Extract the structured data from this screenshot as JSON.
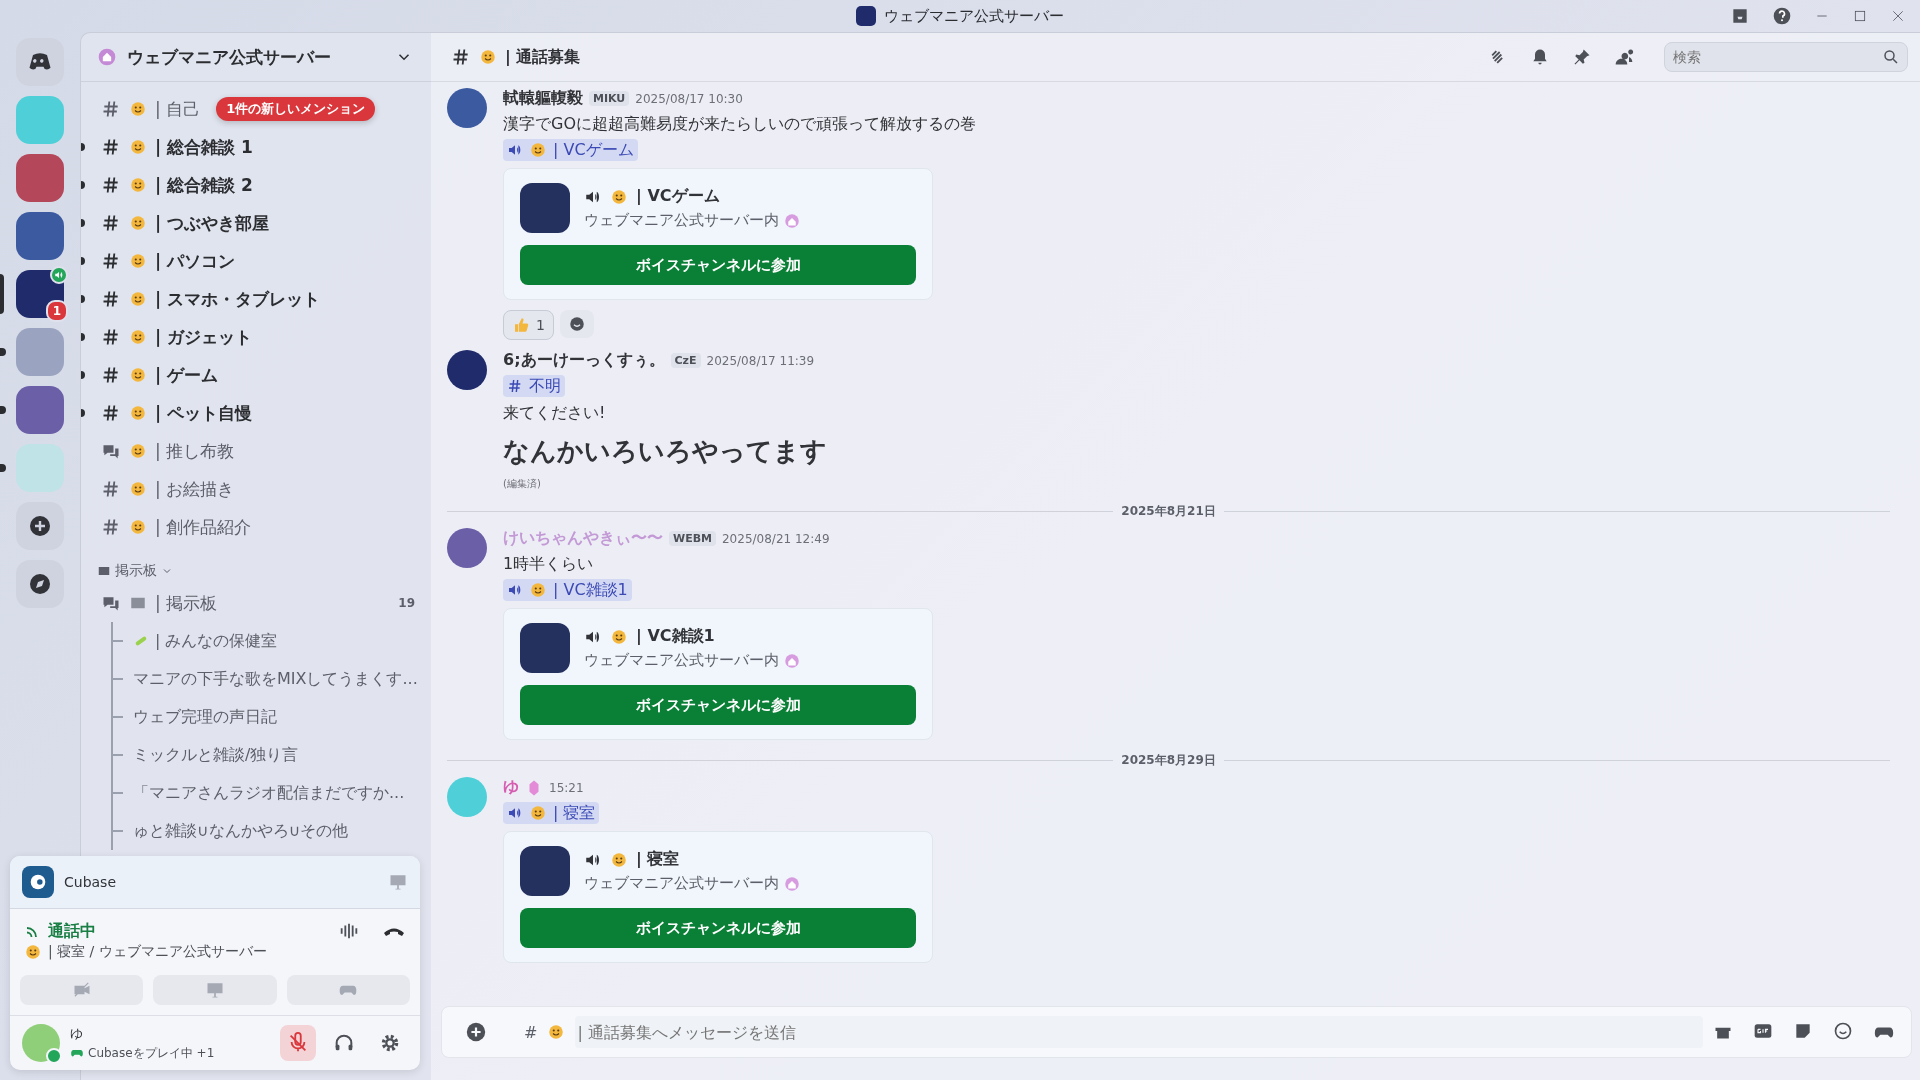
{
  "window": {
    "title": "ウェブマニア公式サーバー"
  },
  "servers": [
    {
      "selected": false,
      "unread": false,
      "voice": false
    },
    {
      "selected": false,
      "unread": false,
      "voice": false
    },
    {
      "selected": false,
      "unread": false,
      "voice": false
    },
    {
      "selected": true,
      "unread": false,
      "voice": true,
      "badge": "1"
    },
    {
      "selected": false,
      "unread": true,
      "voice": false
    },
    {
      "selected": false,
      "unread": true,
      "voice": false
    },
    {
      "selected": false,
      "unread": true,
      "voice": false
    }
  ],
  "server_header": {
    "name": "ウェブマニア公式サーバー"
  },
  "mention_badge": "1件の新しいメンション",
  "channels": [
    {
      "kind": "text",
      "name": "| 自己",
      "unread": false
    },
    {
      "kind": "text",
      "name": "| 総合雑談 1",
      "unread": true
    },
    {
      "kind": "text",
      "name": "| 総合雑談 2",
      "unread": true
    },
    {
      "kind": "text",
      "name": "| つぶやき部屋",
      "unread": true
    },
    {
      "kind": "text",
      "name": "| パソコン",
      "unread": true
    },
    {
      "kind": "text",
      "name": "| スマホ・タブレット",
      "unread": true
    },
    {
      "kind": "text",
      "name": "| ガジェット",
      "unread": true
    },
    {
      "kind": "text",
      "name": "| ゲーム",
      "unread": true
    },
    {
      "kind": "text",
      "name": "| ペット自慢",
      "unread": true
    },
    {
      "kind": "forum",
      "name": "| 推し布教",
      "unread": false
    },
    {
      "kind": "text",
      "name": "| お絵描き",
      "unread": false
    },
    {
      "kind": "text",
      "name": "| 創作品紹介",
      "unread": false
    }
  ],
  "forum_category": {
    "name": "掲示板",
    "expanded": true,
    "channels": [
      {
        "kind": "forum",
        "name": "| 掲示板",
        "count": "19",
        "children": [
          {
            "name": "| みんなの保健室",
            "icon": true
          },
          {
            "name": "マニアの下手な歌をMIXしてうまくす...",
            "icon": false
          },
          {
            "name": "ウェブ完理の声日記",
            "icon": false
          },
          {
            "name": "ミックルと雑談/独り言",
            "icon": false
          },
          {
            "name": "「マニアさんラジオ配信まだですか...",
            "icon": false
          },
          {
            "name": "ゅと雑談∪なんかやろ∪その他",
            "icon": false
          }
        ]
      }
    ]
  },
  "activity": {
    "name": "Cubase"
  },
  "voice": {
    "status": "通話中",
    "channel": "| 寝室 / ウェブマニア公式サーバー"
  },
  "user": {
    "name": "ゆ",
    "activity": "Cubaseをプレイ中",
    "extra": "+1",
    "muted": true
  },
  "chat_header": {
    "channel": "| 通話募集",
    "search_placeholder": "検索"
  },
  "messages": [
    {
      "kind": "message",
      "author": "軾轅軀輹毅",
      "color": "#313338",
      "tag": "MIKU",
      "time": "2025/08/17 10:30",
      "blocks": [
        {
          "kind": "text",
          "text": "漢字でGOに超超高難易度が来たらしいので頑張って解放するの巻"
        },
        {
          "kind": "mention",
          "voice_channel": true,
          "name": "| VCゲーム"
        },
        {
          "kind": "embed",
          "title": "| VCゲーム",
          "server": "ウェブマニア公式サーバー内",
          "button": "ボイスチャンネルに参加"
        },
        {
          "kind": "reactions",
          "items": [
            {
              "count": "1"
            }
          ]
        }
      ]
    },
    {
      "kind": "message",
      "author": "6;あーけーっくすぅ。",
      "color": "#313338",
      "tag": "CzE",
      "time": "2025/08/17 11:39",
      "blocks": [
        {
          "kind": "mention",
          "voice_channel": false,
          "name": "不明"
        },
        {
          "kind": "text",
          "text": "来てください!"
        },
        {
          "kind": "heading",
          "text": "なんかいろいろやってます"
        },
        {
          "kind": "edited",
          "text": "(編集済)"
        }
      ]
    },
    {
      "kind": "divider",
      "text": "2025年8月21日"
    },
    {
      "kind": "message",
      "author": "けいちゃんやきぃ〜〜",
      "color": "#c39ad6",
      "tag": "WEBM",
      "time": "2025/08/21 12:49",
      "blocks": [
        {
          "kind": "text",
          "text": "1時半くらい"
        },
        {
          "kind": "mention",
          "voice_channel": true,
          "name": "| VC雑談1"
        },
        {
          "kind": "embed",
          "title": "| VC雑談1",
          "server": "ウェブマニア公式サーバー内",
          "button": "ボイスチャンネルに参加"
        }
      ]
    },
    {
      "kind": "divider",
      "text": "2025年8月29日"
    },
    {
      "kind": "message",
      "author": "ゆ",
      "color": "#d65db1",
      "time": "15:21",
      "blocks": [
        {
          "kind": "mention",
          "voice_channel": true,
          "name": "| 寝室"
        },
        {
          "kind": "embed",
          "title": "| 寝室",
          "server": "ウェブマニア公式サーバー内",
          "button": "ボイスチャンネルに参加"
        }
      ]
    }
  ],
  "composer": {
    "prefix": "#",
    "placeholder": "| 通話募集へメッセージを送信"
  }
}
